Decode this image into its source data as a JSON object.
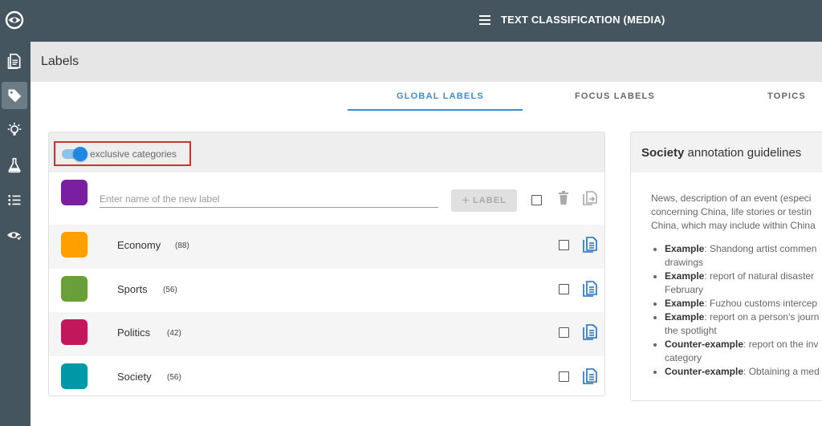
{
  "app": {
    "title": "TEXT CLASSIFICATION (MEDIA)"
  },
  "page": {
    "title": "Labels"
  },
  "tabs": [
    {
      "label": "GLOBAL LABELS",
      "active": true
    },
    {
      "label": "FOCUS LABELS",
      "active": false
    },
    {
      "label": "TOPICS",
      "active": false
    }
  ],
  "labels_panel": {
    "toggle_label": "exclusive categories",
    "toggle_on": true,
    "new_label": {
      "placeholder": "Enter name of the new label",
      "color": "#7b1fa2",
      "add_button": "LABEL"
    },
    "labels": [
      {
        "name": "Economy",
        "count": "(88)",
        "color": "#ffa000"
      },
      {
        "name": "Sports",
        "count": "(56)",
        "color": "#689f38"
      },
      {
        "name": "Politics",
        "count": "(42)",
        "color": "#c2185b"
      },
      {
        "name": "Society",
        "count": "(56)",
        "color": "#0097a7"
      }
    ]
  },
  "guidelines": {
    "title_bold": "Society",
    "title_rest": " annotation guidelines",
    "description": "News, description of an event (especi\nconcerning China, life stories or testin\nChina, which may include within China",
    "items": [
      {
        "prefix": "Example",
        "text": ": Shandong artist commen\ndrawings"
      },
      {
        "prefix": "Example",
        "text": ": report of natural disaster\nFebruary"
      },
      {
        "prefix": "Example",
        "text": ": Fuzhou customs intercep"
      },
      {
        "prefix": "Example",
        "text": ": report on a person's journ\nthe spotlight"
      },
      {
        "prefix": "Counter-example",
        "text": ": report on the inv\ncategory"
      },
      {
        "prefix": "Counter-example",
        "text": ": Obtaining a med"
      }
    ]
  },
  "colors": {
    "sidebar": "#44555f",
    "accent": "#3f8bd1",
    "highlight_box": "#d32f2f"
  },
  "icons": [
    "eye-logo-icon",
    "document-icon",
    "tag-icon",
    "lightbulb-icon",
    "flask-icon",
    "list-icon",
    "eye-check-icon",
    "menu-icon",
    "delete-icon",
    "copy-icon",
    "guidelines-icon"
  ]
}
